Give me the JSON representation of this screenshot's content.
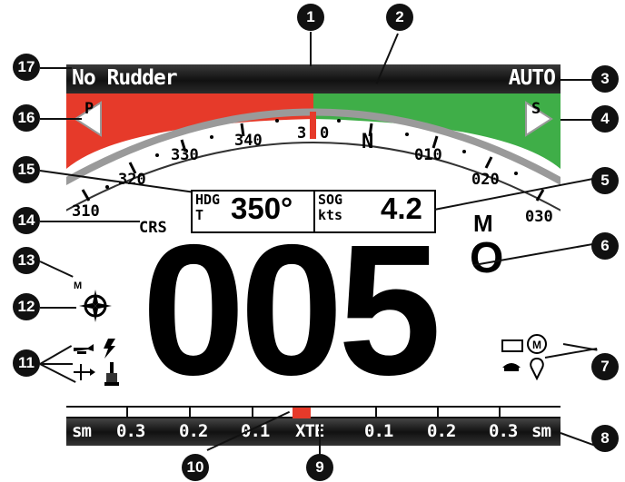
{
  "top_bar": {
    "mode_left": "No Rudder",
    "mode_right": "AUTO"
  },
  "compass": {
    "labels": [
      "310",
      "320",
      "330",
      "340",
      "3",
      "0",
      "N",
      "010",
      "020",
      "030"
    ],
    "port_label": "P",
    "starboard_label": "S",
    "port_color": "#e63a2a",
    "starboard_color": "#3fae48"
  },
  "crs_label": "CRS",
  "heading_box": {
    "label_line1": "HDG",
    "label_line2": "T",
    "value": "350°"
  },
  "sog_box": {
    "label_line1": "SOG",
    "label_line2": "kts",
    "value": "4.2"
  },
  "locked_heading": {
    "value": "005",
    "suffix_letter": "M",
    "degree_symbol": "O"
  },
  "icons_left": {
    "m_label": "M"
  },
  "xte_bar": {
    "labels": [
      "sm",
      "0.3",
      "0.2",
      "0.1",
      "XTE",
      "0.1",
      "0.2",
      "0.3",
      "sm"
    ]
  },
  "callouts": [
    "1",
    "2",
    "3",
    "4",
    "5",
    "6",
    "7",
    "8",
    "9",
    "10",
    "11",
    "12",
    "13",
    "14",
    "15",
    "16",
    "17"
  ]
}
